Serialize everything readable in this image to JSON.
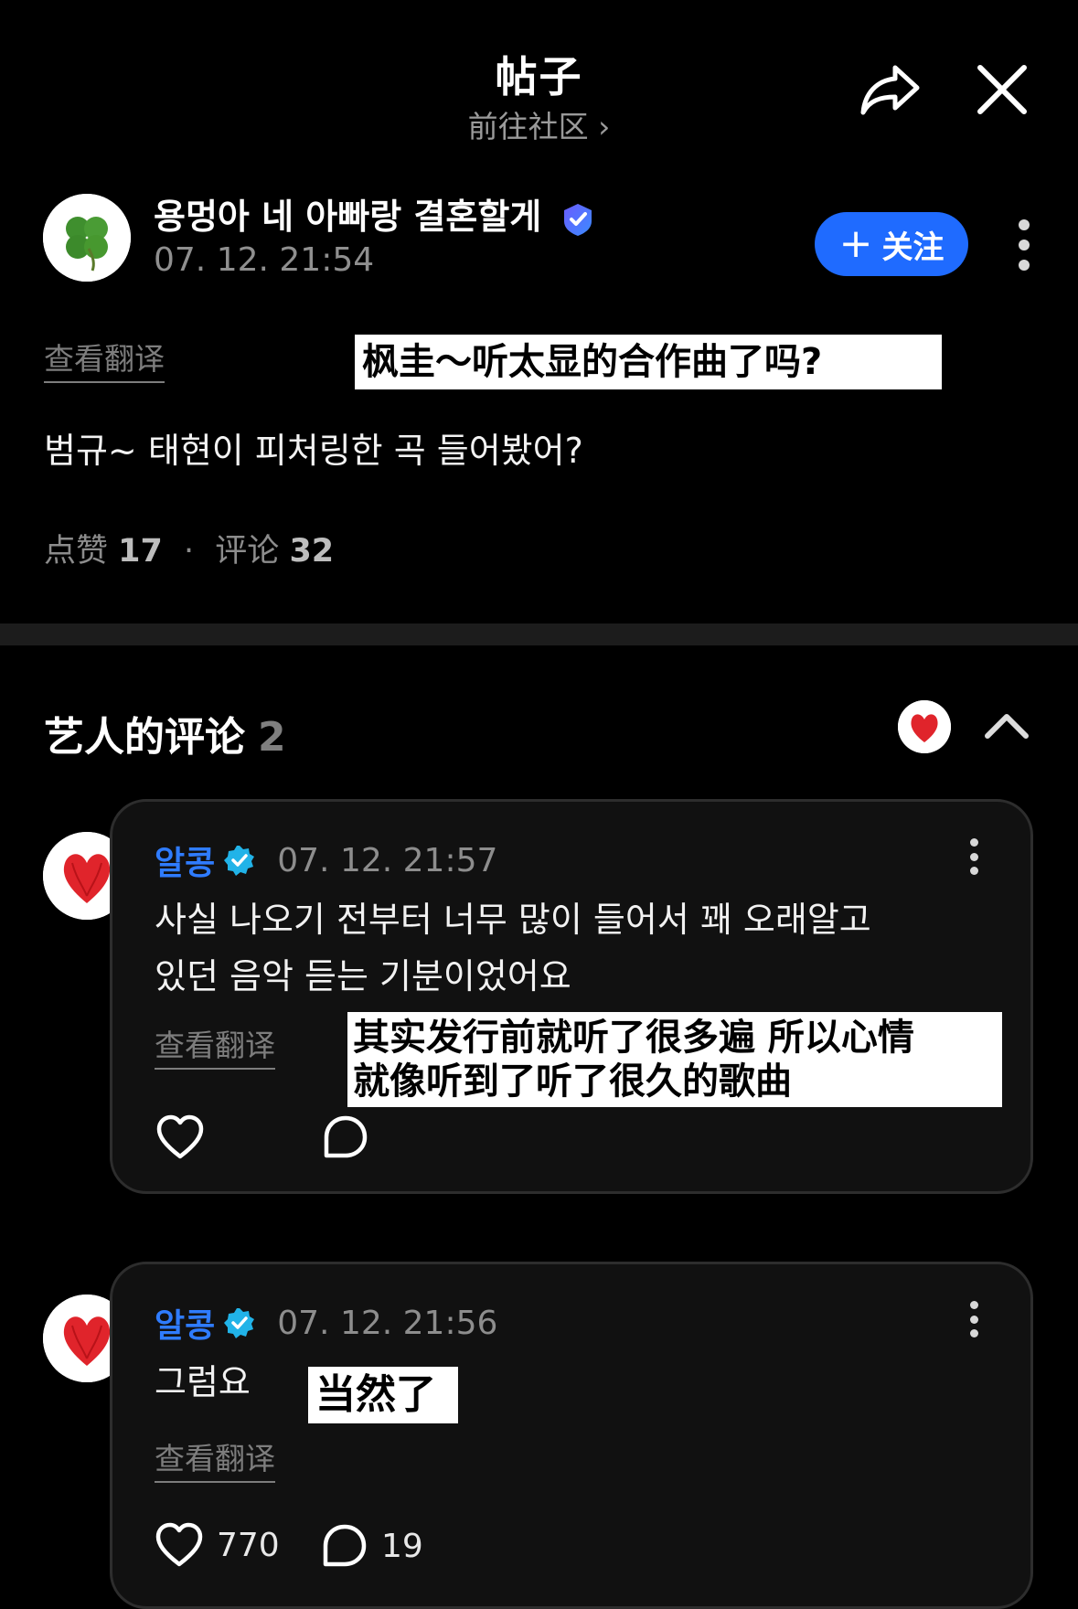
{
  "header": {
    "title": "帖子",
    "subtitle": "前往社区",
    "subtitle_chevron": "›"
  },
  "post": {
    "author_name": "용멍아 네 아빠랑 결혼할게",
    "time": "07. 12. 21:54",
    "follow_label": "关注",
    "follow_plus": "+",
    "see_translation": "查看翻译",
    "overlay_translation": "枫圭～听太显的合作曲了吗?",
    "text": "범규~ 태현이 피처링한 곡 들어봤어?",
    "likes_label": "点赞",
    "likes_count": "17",
    "separator": "·",
    "comments_label": "评论",
    "comments_count": "32"
  },
  "artist_comments": {
    "title": "艺人的评论",
    "count": "2",
    "items": [
      {
        "name": "알콩",
        "time": "07. 12. 21:57",
        "text_line1": "사실 나오기 전부터 너무 많이 들어서 꽤 오래알고",
        "text_line2": "있던 음악 듣는 기분이었어요",
        "see_translation": "查看翻译",
        "overlay_line1": "其实发行前就听了很多遍 所以心情",
        "overlay_line2": "就像听到了听了很久的歌曲"
      },
      {
        "name": "알콩",
        "time": "07. 12. 21:56",
        "text_line1": "그럼요",
        "see_translation": "查看翻译",
        "overlay_line1": "当然了",
        "like_count": "770",
        "reply_count": "19"
      }
    ]
  },
  "icons": {
    "share": "share-icon",
    "close": "close-icon",
    "more": "more-vertical-icon",
    "verified": "verified-badge-icon",
    "like": "heart-icon",
    "reply": "comment-bubble-icon",
    "collapse": "chevron-up-icon"
  },
  "colors": {
    "background": "#000000",
    "accent_blue": "#1f6bff",
    "name_blue": "#2f7cff",
    "verified_teal": "#21b3e8",
    "muted_text": "#8d8d8d",
    "card_bg": "#111111"
  }
}
